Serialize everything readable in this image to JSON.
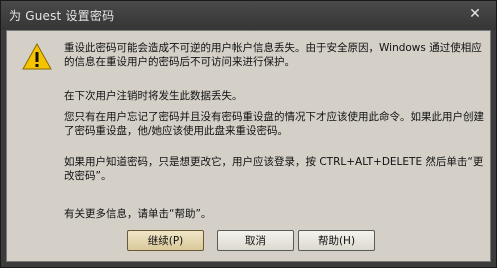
{
  "window": {
    "title": "为 Guest 设置密码",
    "close_glyph": "✕"
  },
  "message": {
    "icon": "warning-icon",
    "paragraphs": [
      "重设此密码可能会造成不可逆的用户帐户信息丢失。由于安全原因，Windows 通过使相应的信息在重设用户的密码后不可访问来进行保护。",
      "在下次用户注销时将发生此数据丢失。",
      "您只有在用户忘记了密码并且没有密码重设盘的情况下才应该使用此命令。如果此用户创建了密码重设盘，他/她应该使用此盘来重设密码。",
      "如果用户知道密码，只是想更改它，用户应该登录，按 CTRL+ALT+DELETE 然后单击“更改密码”。",
      "有关更多信息，请单击“帮助”。"
    ]
  },
  "buttons": {
    "continue_label": "继续(P)",
    "cancel_label": "取消",
    "help_label": "帮助(H)"
  },
  "colors": {
    "dialog_bg": "#d4d0c8",
    "frame": "#3c3c3c",
    "warning_yellow": "#f5c400"
  }
}
